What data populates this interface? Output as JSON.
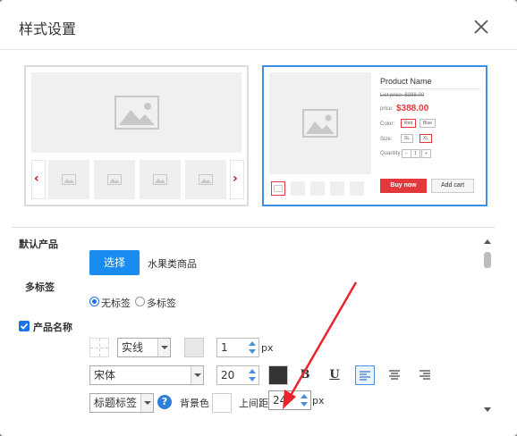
{
  "dialog": {
    "title": "样式设置"
  },
  "preview_b": {
    "product_name": "Product Name",
    "list_price": "List price: $388.00",
    "price_label": "price:",
    "price": "$388.00",
    "color_label": "Color:",
    "colors": [
      "Red",
      "Blue"
    ],
    "size_label": "Size:",
    "sizes": [
      "SL",
      "XL"
    ],
    "quantity_label": "Quantity:",
    "quantity": "1",
    "buy_now": "Buy now",
    "add_cart": "Add cart"
  },
  "form": {
    "default_product_label": "默认产品",
    "choose_button": "选择",
    "chosen_product": "水果类商品",
    "multi_tab_label": "多标签",
    "radio_options": [
      "无标签",
      "多标签"
    ],
    "selected_radio": 0,
    "product_name_label": "产品名称",
    "product_name_checked": true,
    "border_style": "实线",
    "border_width": "1",
    "border_width_unit": "px",
    "font_family": "宋体",
    "font_size": "20",
    "text_color": "#333333",
    "bold_label": "B",
    "underline_label": "U",
    "tag_type": "标题标签",
    "help": "?",
    "bg_color_label": "背景色",
    "margin_top_label": "上间距",
    "margin_top": "24",
    "margin_top_unit": "px"
  },
  "colors": {
    "accent": "#1a8cf0",
    "selected_border": "#3c8fe3",
    "price_red": "#e4393c",
    "annotation": "#e8232b"
  }
}
